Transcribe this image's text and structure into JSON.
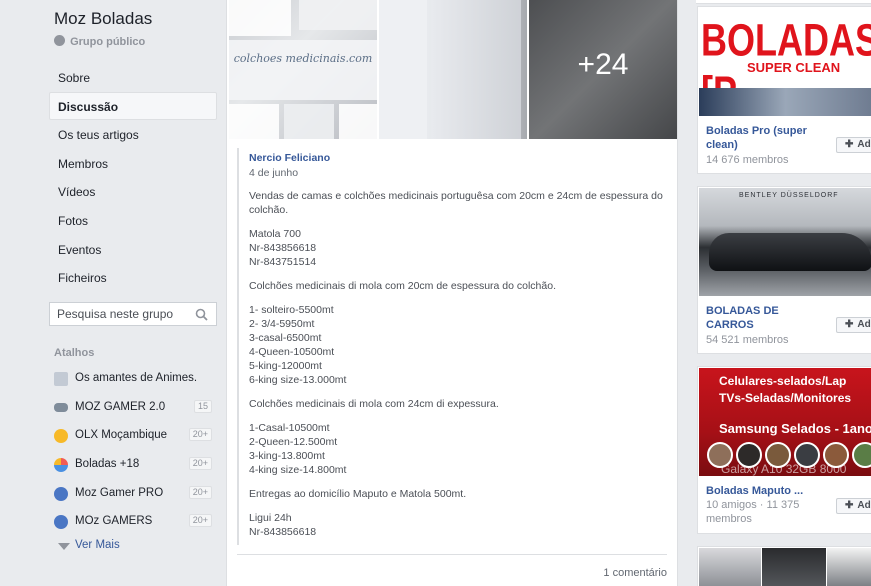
{
  "group": {
    "name": "Moz Boladas",
    "type": "Grupo público"
  },
  "nav": [
    {
      "label": "Sobre"
    },
    {
      "label": "Discussão",
      "active": true
    },
    {
      "label": "Os teus artigos"
    },
    {
      "label": "Membros"
    },
    {
      "label": "Vídeos"
    },
    {
      "label": "Fotos"
    },
    {
      "label": "Eventos"
    },
    {
      "label": "Ficheiros"
    }
  ],
  "search": {
    "placeholder": "Pesquisa neste grupo"
  },
  "shortcuts": {
    "title": "Atalhos",
    "items": [
      {
        "label": "Os amantes de Animes.",
        "badge": "",
        "icon": "flag-icon",
        "color": "#b0b8c4"
      },
      {
        "label": "MOZ GAMER 2.0",
        "badge": "15",
        "icon": "gamepad-icon",
        "color": "#7f8c9a"
      },
      {
        "label": "OLX Moçambique",
        "badge": "20+",
        "icon": "group-avatar-icon",
        "color": "#f7b928"
      },
      {
        "label": "Boladas +18",
        "badge": "20+",
        "icon": "pie-avatar-icon",
        "color": "#4a90e2"
      },
      {
        "label": "Moz Gamer PRO",
        "badge": "20+",
        "icon": "group-icon",
        "color": "#4a76c4"
      },
      {
        "label": "MOz GAMERS",
        "badge": "20+",
        "icon": "group-icon",
        "color": "#4a76c4"
      }
    ],
    "see_more": "Ver Mais"
  },
  "post": {
    "photos": {
      "watermark": "colchoes medicinais.com",
      "more_count": "+24"
    },
    "author": "Nercio Feliciano",
    "date": "4 de junho",
    "paragraphs": [
      "Vendas de camas e colchões medicinais portuguêsa com 20cm e 24cm de espessura do colchão.",
      "Matola 700\nNr-843856618\nNr-843751514",
      "Colchões medicinais di mola com 20cm de espessura do colchão.",
      "1- solteiro-5500mt\n2- 3/4-5950mt\n3-casal-6500mt\n4-Queen-10500mt\n5-king-12000mt\n6-king size-13.000mt",
      "Colchões medicinais di mola com 24cm di expessura.",
      "1-Casal-10500mt\n2-Queen-12.500mt\n3-king-13.800mt\n4-king size-14.800mt",
      "Entregas ao domicílio Maputo e Matola 500mt.",
      "Ligui 24h\nNr-843856618"
    ],
    "comment_count": "1 comentário"
  },
  "suggested": [
    {
      "name": "Boladas Pro (super clean)",
      "meta": "14 676 membros",
      "join_label": "Ad",
      "image_text": "BOLADAS [P",
      "image_subtext": "SUPER CLEAN"
    },
    {
      "name": "BOLADAS DE CARROS",
      "meta": "54 521 membros",
      "join_label": "Ad",
      "image_text": "BENTLEY DÜSSELDORF"
    },
    {
      "name": "Boladas Maputo ...",
      "meta": "10 amigos · 11 375 membros",
      "join_label": "Ad",
      "image_line1": "Celulares-selados/Lap",
      "image_line2": "TVs-Seladas/Monitores",
      "image_line3": "Samsung Selados - 1ano",
      "image_line4": "Galaxy A10 32GB 8000"
    }
  ]
}
